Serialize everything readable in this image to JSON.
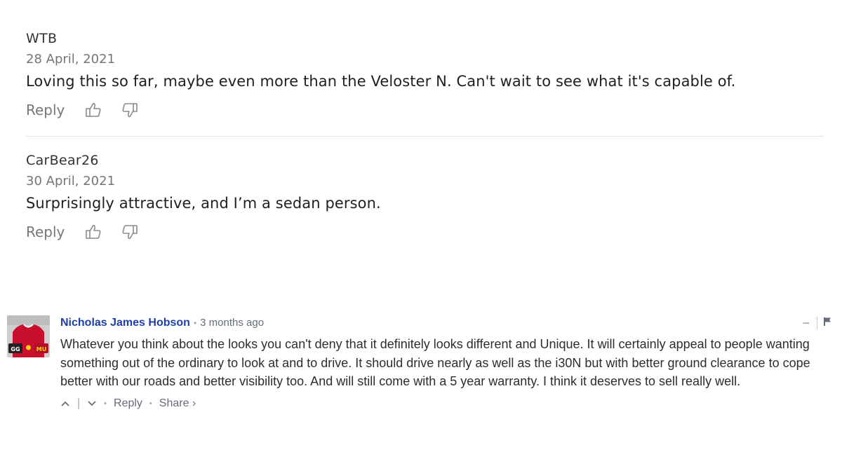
{
  "comments": [
    {
      "author": "WTB",
      "date": "28 April, 2021",
      "text": "Loving this so far, maybe even more than the Veloster N. Can't wait to see what it's capable of.",
      "reply_label": "Reply"
    },
    {
      "author": "CarBear26",
      "date": "30 April, 2021",
      "text": "Surprisingly attractive, and I’m a sedan person.",
      "reply_label": "Reply"
    }
  ],
  "disqus_comment": {
    "author": "Nicholas James Hobson",
    "separator": "•",
    "time": "3 months ago",
    "text": "Whatever you think about the looks you can't deny that it definitely looks different and Unique. It will certainly appeal to people wanting something out of the ordinary to look at and to drive. It should drive nearly as well as the i30N but with better ground clearance to cope better with our roads and better visibility too. And will still come with a 5 year warranty. I think it deserves to sell really well.",
    "reply_label": "Reply",
    "share_label": "Share ›",
    "collapse_label": "−",
    "avatar_text_left": "GG",
    "avatar_text_right": "MU"
  },
  "colors": {
    "author_link": "#1e3fa8",
    "muted": "#757575",
    "jersey_red": "#c8102e"
  },
  "icons": [
    "thumbs-up-icon",
    "thumbs-down-icon",
    "upvote-icon",
    "downvote-icon",
    "flag-icon"
  ]
}
